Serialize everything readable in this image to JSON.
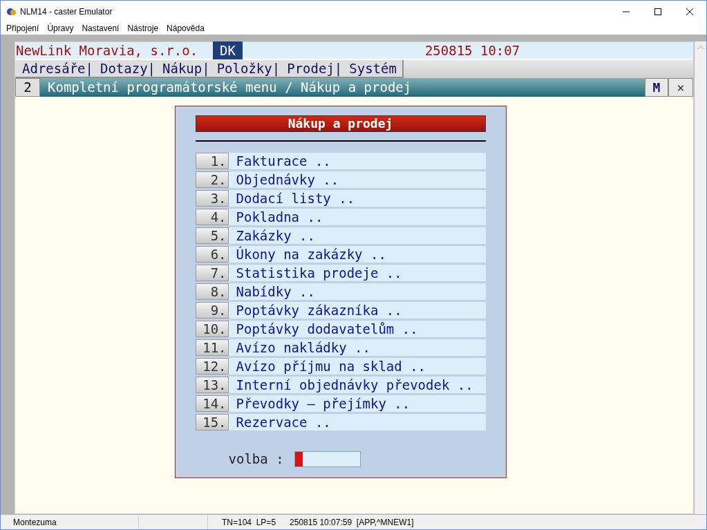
{
  "window": {
    "title": "NLM14 - caster Emulator"
  },
  "menu": [
    "Připojení",
    "Úpravy",
    "Nastavení",
    "Nástroje",
    "Nápověda"
  ],
  "header": {
    "company": "NewLink Moravia, s.r.o.",
    "user": "DK",
    "datetime": "250815 10:07"
  },
  "app_menu": [
    "Adresáře|",
    "Dotazy|",
    "Nákup|",
    "Položky|",
    "Prodej|",
    "Systém"
  ],
  "title_row": {
    "level": "2",
    "title": "Kompletní programátorské menu / Nákup a prodej",
    "m_button": "M",
    "close": "×"
  },
  "dialog": {
    "title": "Nákup a prodej",
    "items": [
      {
        "number": "1.",
        "label": "Fakturace .."
      },
      {
        "number": "2.",
        "label": "Objednávky .."
      },
      {
        "number": "3.",
        "label": "Dodací listy .."
      },
      {
        "number": "4.",
        "label": "Pokladna .."
      },
      {
        "number": "5.",
        "label": "Zakázky .."
      },
      {
        "number": "6.",
        "label": "Úkony na zakázky .."
      },
      {
        "number": "7.",
        "label": "Statistika prodeje .."
      },
      {
        "number": "8.",
        "label": "Nabídky .."
      },
      {
        "number": "9.",
        "label": "Poptávky zákazníka .."
      },
      {
        "number": "10.",
        "label": "Poptávky dodavatelům .."
      },
      {
        "number": "11.",
        "label": "Avízo nakládky .."
      },
      {
        "number": "12.",
        "label": "Avízo příjmu na sklad .."
      },
      {
        "number": "13.",
        "label": "Interní objednávky převodek .."
      },
      {
        "number": "14.",
        "label": "Převodky – přejímky .."
      },
      {
        "number": "15.",
        "label": "Rezervace .."
      }
    ],
    "choice_label": "volba :"
  },
  "status_bar": [
    "Montezuma",
    "TN=104  LP=5",
    "250815 10:07:59  [APP,^MNEW1]"
  ]
}
